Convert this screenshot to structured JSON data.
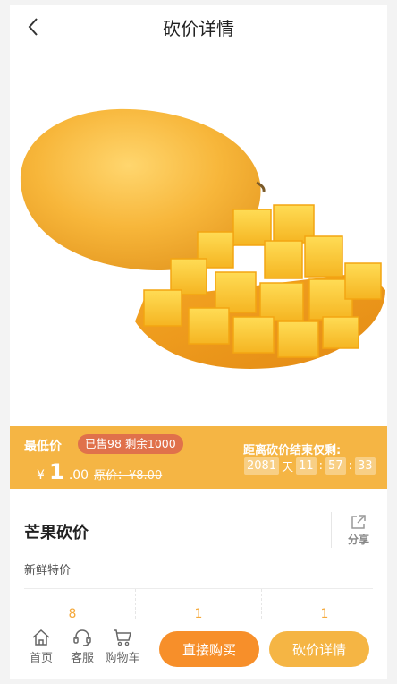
{
  "header": {
    "title": "砍价详情"
  },
  "price_banner": {
    "lowest_label": "最低价",
    "sold_badge": "已售98 剩余1000",
    "currency": "¥",
    "price_int": "1",
    "price_dec": ".00",
    "original_price": "原价：¥8.00",
    "countdown_label": "距离砍价结束仅剩:",
    "countdown": {
      "days": "2081",
      "day_unit": "天",
      "hours": "11",
      "minutes": "57",
      "seconds": "33",
      "sep": ":"
    }
  },
  "product": {
    "name": "芒果砍价",
    "subtitle": "新鲜特价",
    "share_label": "分享",
    "stats": [
      "8",
      "1",
      "1"
    ]
  },
  "bottom_bar": {
    "home_label": "首页",
    "service_label": "客服",
    "cart_label": "购物车",
    "buy_label": "直接购买",
    "detail_label": "砍价详情"
  },
  "colors": {
    "accent": "#f5b544",
    "buy": "#f78f2a",
    "badge": "#e0714b"
  }
}
